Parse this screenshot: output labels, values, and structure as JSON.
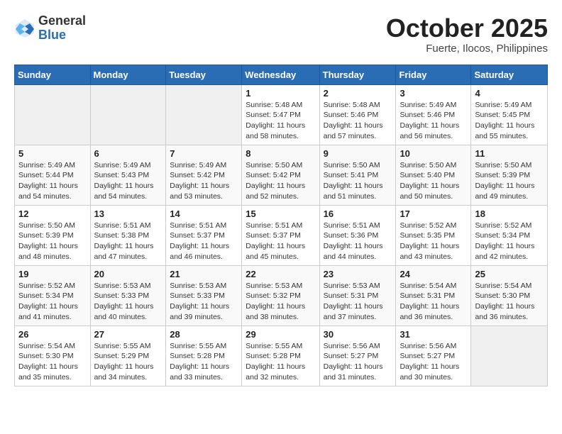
{
  "logo": {
    "general": "General",
    "blue": "Blue"
  },
  "header": {
    "month": "October 2025",
    "location": "Fuerte, Ilocos, Philippines"
  },
  "weekdays": [
    "Sunday",
    "Monday",
    "Tuesday",
    "Wednesday",
    "Thursday",
    "Friday",
    "Saturday"
  ],
  "weeks": [
    [
      {
        "day": "",
        "info": ""
      },
      {
        "day": "",
        "info": ""
      },
      {
        "day": "",
        "info": ""
      },
      {
        "day": "1",
        "info": "Sunrise: 5:48 AM\nSunset: 5:47 PM\nDaylight: 11 hours\nand 58 minutes."
      },
      {
        "day": "2",
        "info": "Sunrise: 5:48 AM\nSunset: 5:46 PM\nDaylight: 11 hours\nand 57 minutes."
      },
      {
        "day": "3",
        "info": "Sunrise: 5:49 AM\nSunset: 5:46 PM\nDaylight: 11 hours\nand 56 minutes."
      },
      {
        "day": "4",
        "info": "Sunrise: 5:49 AM\nSunset: 5:45 PM\nDaylight: 11 hours\nand 55 minutes."
      }
    ],
    [
      {
        "day": "5",
        "info": "Sunrise: 5:49 AM\nSunset: 5:44 PM\nDaylight: 11 hours\nand 54 minutes."
      },
      {
        "day": "6",
        "info": "Sunrise: 5:49 AM\nSunset: 5:43 PM\nDaylight: 11 hours\nand 54 minutes."
      },
      {
        "day": "7",
        "info": "Sunrise: 5:49 AM\nSunset: 5:42 PM\nDaylight: 11 hours\nand 53 minutes."
      },
      {
        "day": "8",
        "info": "Sunrise: 5:50 AM\nSunset: 5:42 PM\nDaylight: 11 hours\nand 52 minutes."
      },
      {
        "day": "9",
        "info": "Sunrise: 5:50 AM\nSunset: 5:41 PM\nDaylight: 11 hours\nand 51 minutes."
      },
      {
        "day": "10",
        "info": "Sunrise: 5:50 AM\nSunset: 5:40 PM\nDaylight: 11 hours\nand 50 minutes."
      },
      {
        "day": "11",
        "info": "Sunrise: 5:50 AM\nSunset: 5:39 PM\nDaylight: 11 hours\nand 49 minutes."
      }
    ],
    [
      {
        "day": "12",
        "info": "Sunrise: 5:50 AM\nSunset: 5:39 PM\nDaylight: 11 hours\nand 48 minutes."
      },
      {
        "day": "13",
        "info": "Sunrise: 5:51 AM\nSunset: 5:38 PM\nDaylight: 11 hours\nand 47 minutes."
      },
      {
        "day": "14",
        "info": "Sunrise: 5:51 AM\nSunset: 5:37 PM\nDaylight: 11 hours\nand 46 minutes."
      },
      {
        "day": "15",
        "info": "Sunrise: 5:51 AM\nSunset: 5:37 PM\nDaylight: 11 hours\nand 45 minutes."
      },
      {
        "day": "16",
        "info": "Sunrise: 5:51 AM\nSunset: 5:36 PM\nDaylight: 11 hours\nand 44 minutes."
      },
      {
        "day": "17",
        "info": "Sunrise: 5:52 AM\nSunset: 5:35 PM\nDaylight: 11 hours\nand 43 minutes."
      },
      {
        "day": "18",
        "info": "Sunrise: 5:52 AM\nSunset: 5:34 PM\nDaylight: 11 hours\nand 42 minutes."
      }
    ],
    [
      {
        "day": "19",
        "info": "Sunrise: 5:52 AM\nSunset: 5:34 PM\nDaylight: 11 hours\nand 41 minutes."
      },
      {
        "day": "20",
        "info": "Sunrise: 5:53 AM\nSunset: 5:33 PM\nDaylight: 11 hours\nand 40 minutes."
      },
      {
        "day": "21",
        "info": "Sunrise: 5:53 AM\nSunset: 5:33 PM\nDaylight: 11 hours\nand 39 minutes."
      },
      {
        "day": "22",
        "info": "Sunrise: 5:53 AM\nSunset: 5:32 PM\nDaylight: 11 hours\nand 38 minutes."
      },
      {
        "day": "23",
        "info": "Sunrise: 5:53 AM\nSunset: 5:31 PM\nDaylight: 11 hours\nand 37 minutes."
      },
      {
        "day": "24",
        "info": "Sunrise: 5:54 AM\nSunset: 5:31 PM\nDaylight: 11 hours\nand 36 minutes."
      },
      {
        "day": "25",
        "info": "Sunrise: 5:54 AM\nSunset: 5:30 PM\nDaylight: 11 hours\nand 36 minutes."
      }
    ],
    [
      {
        "day": "26",
        "info": "Sunrise: 5:54 AM\nSunset: 5:30 PM\nDaylight: 11 hours\nand 35 minutes."
      },
      {
        "day": "27",
        "info": "Sunrise: 5:55 AM\nSunset: 5:29 PM\nDaylight: 11 hours\nand 34 minutes."
      },
      {
        "day": "28",
        "info": "Sunrise: 5:55 AM\nSunset: 5:28 PM\nDaylight: 11 hours\nand 33 minutes."
      },
      {
        "day": "29",
        "info": "Sunrise: 5:55 AM\nSunset: 5:28 PM\nDaylight: 11 hours\nand 32 minutes."
      },
      {
        "day": "30",
        "info": "Sunrise: 5:56 AM\nSunset: 5:27 PM\nDaylight: 11 hours\nand 31 minutes."
      },
      {
        "day": "31",
        "info": "Sunrise: 5:56 AM\nSunset: 5:27 PM\nDaylight: 11 hours\nand 30 minutes."
      },
      {
        "day": "",
        "info": ""
      }
    ]
  ]
}
